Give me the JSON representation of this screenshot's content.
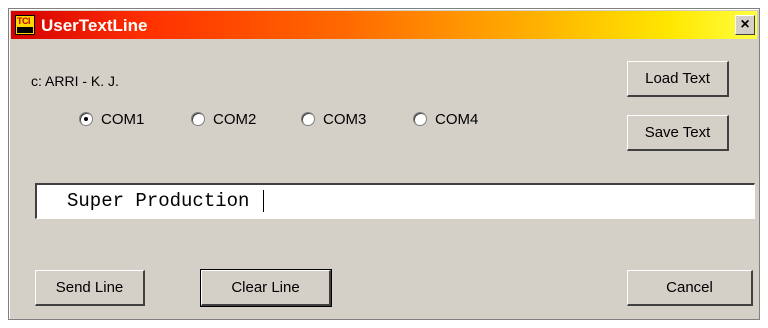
{
  "window": {
    "title": "UserTextLine",
    "icon_label": "TCI",
    "close_label": "×"
  },
  "credit": "c: ARRI - K. J.",
  "ports": {
    "options": [
      "COM1",
      "COM2",
      "COM3",
      "COM4"
    ],
    "selected": "COM1"
  },
  "buttons": {
    "load_text": "Load Text",
    "save_text": "Save Text",
    "send_line": "Send Line",
    "clear_line": "Clear Line",
    "cancel": "Cancel"
  },
  "text_line": {
    "value": "Super Production "
  },
  "colors": {
    "face": "#d4d0c8",
    "title_gradient_start": "#d40000",
    "title_gradient_end": "#ffff40"
  }
}
